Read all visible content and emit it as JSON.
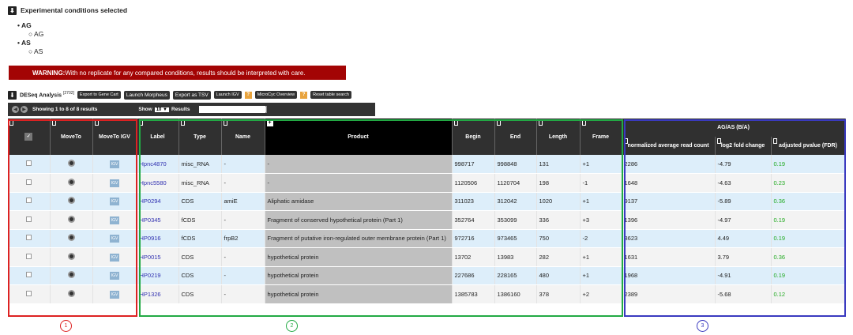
{
  "conditions": {
    "header": "Experimental conditions selected",
    "items": [
      {
        "name": "AG",
        "sub": "AG"
      },
      {
        "name": "AS",
        "sub": "AS"
      }
    ]
  },
  "warning": {
    "bold": "WARNING:",
    "text": "With no replicate for any compared conditions, results should be interpreted with care."
  },
  "toolbar": {
    "title": "DESeq Analysis",
    "count": "[2702]",
    "buttons": [
      "Export to Gene Cart",
      "Launch Morpheus",
      "Export as TSV",
      "Launch IGV",
      "MicroCyc Overview",
      "Reset table search"
    ]
  },
  "pager": {
    "showing": "Showing 1 to 8 of 8 results",
    "show": "Show",
    "show_value": "10",
    "results": "Results"
  },
  "group_header": "AG/AS (B/A)",
  "columns": {
    "moveto": "MoveTo",
    "moveto_igv": "MoveTo IGV",
    "label": "Label",
    "type": "Type",
    "name": "Name",
    "product": "Product",
    "begin": "Begin",
    "end": "End",
    "length": "Length",
    "frame": "Frame",
    "nrc": "normalized average read count",
    "lfc": "log2 fold change",
    "pval": "adjusted pvalue (FDR)"
  },
  "icons": {
    "checkbox": "checkbox-icon",
    "move": "magnifier-icon",
    "igv": "igv-icon"
  },
  "rows": [
    {
      "label": "Hpnc4870",
      "type": "misc_RNA",
      "name": "-",
      "product": "-",
      "begin": "998717",
      "end": "998848",
      "length": "131",
      "frame": "+1",
      "nrc": "2286",
      "lfc": "-4.79",
      "pval": "0.19"
    },
    {
      "label": "Hpnc5580",
      "type": "misc_RNA",
      "name": "-",
      "product": "-",
      "begin": "1120506",
      "end": "1120704",
      "length": "198",
      "frame": "-1",
      "nrc": "1648",
      "lfc": "-4.63",
      "pval": "0.23"
    },
    {
      "label": "HP0294",
      "type": "CDS",
      "name": "amiE",
      "product": "Aliphatic amidase",
      "begin": "311023",
      "end": "312042",
      "length": "1020",
      "frame": "+1",
      "nrc": "9137",
      "lfc": "-5.89",
      "pval": "0.36"
    },
    {
      "label": "HP0345",
      "type": "fCDS",
      "name": "-",
      "product": "Fragment of conserved hypothetical protein (Part 1)",
      "begin": "352764",
      "end": "353099",
      "length": "336",
      "frame": "+3",
      "nrc": "1396",
      "lfc": "-4.97",
      "pval": "0.19"
    },
    {
      "label": "HP0916",
      "type": "fCDS",
      "name": "frpB2",
      "product": "Fragment of putative iron-regulated outer membrane protein (Part 1)",
      "begin": "972716",
      "end": "973465",
      "length": "750",
      "frame": "-2",
      "nrc": "3623",
      "lfc": "4.49",
      "pval": "0.19"
    },
    {
      "label": "HP0015",
      "type": "CDS",
      "name": "-",
      "product": "hypothetical protein",
      "begin": "13702",
      "end": "13983",
      "length": "282",
      "frame": "+1",
      "nrc": "1631",
      "lfc": "3.79",
      "pval": "0.36"
    },
    {
      "label": "HP0219",
      "type": "CDS",
      "name": "-",
      "product": "hypothetical protein",
      "begin": "227686",
      "end": "228165",
      "length": "480",
      "frame": "+1",
      "nrc": "1968",
      "lfc": "-4.91",
      "pval": "0.19"
    },
    {
      "label": "HP1326",
      "type": "CDS",
      "name": "-",
      "product": "hypothetical protein",
      "begin": "1385783",
      "end": "1386160",
      "length": "378",
      "frame": "+2",
      "nrc": "2389",
      "lfc": "-5.68",
      "pval": "0.12"
    }
  ],
  "annotations": [
    "1",
    "2",
    "3"
  ],
  "colors": {
    "warning": "#a30404",
    "box1": "#dd2222",
    "box2": "#22aa44",
    "box3": "#3a3ac0",
    "pvalue": "#22aa22"
  }
}
